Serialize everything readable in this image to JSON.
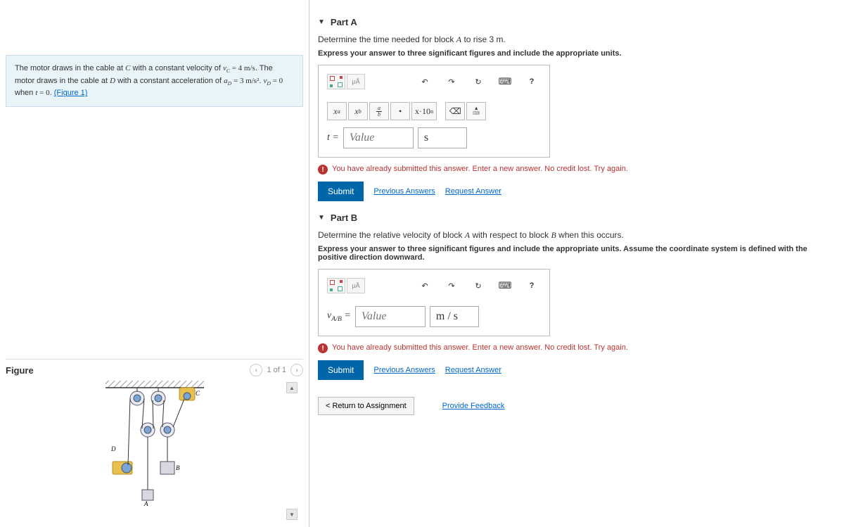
{
  "problem": {
    "text_prefix": "The motor draws in the cable at ",
    "var_c": "C",
    "text_mid1": " with a constant velocity of ",
    "vc": "v_C = 4 m/s",
    "text_mid2": ". The motor draws in the cable at ",
    "var_d": "D",
    "text_mid3": " with a constant acceleration of ",
    "ad": "a_D = 3 m/s²",
    "text_mid4": ". ",
    "vd": "v_D = 0",
    "text_mid5": " when ",
    "t0": "t = 0",
    "text_end": ". ",
    "figure_link": "(Figure 1)"
  },
  "figure": {
    "title": "Figure",
    "page": "1 of 1",
    "labels": {
      "a": "A",
      "b": "B",
      "c": "C",
      "d": "D"
    }
  },
  "partA": {
    "label": "Part A",
    "question_prefix": "Determine the time needed for block ",
    "var_a": "A",
    "question_suffix": " to rise 3 m.",
    "instruction": "Express your answer to three significant figures and include the appropriate units.",
    "var_label": "t =",
    "value_placeholder": "Value",
    "unit_value": "s",
    "feedback": "You have already submitted this answer. Enter a new answer. No credit lost. Try again.",
    "submit": "Submit",
    "prev_answers": "Previous Answers",
    "request_answer": "Request Answer",
    "tools": {
      "xa": "xᵃ",
      "xb": "x_b",
      "frac": "a/b",
      "dot": "•",
      "sci": "x·10ⁿ"
    }
  },
  "partB": {
    "label": "Part B",
    "question_prefix": "Determine the relative velocity of block ",
    "var_a": "A",
    "question_mid": " with respect to block ",
    "var_b": "B",
    "question_suffix": " when this occurs.",
    "instruction": "Express your answer to three significant figures and include the appropriate units. Assume the coordinate system is defined with the positive direction downward.",
    "var_label": "v_{A/B} =",
    "value_placeholder": "Value",
    "unit_value": "m / s",
    "feedback": "You have already submitted this answer. Enter a new answer. No credit lost. Try again.",
    "submit": "Submit",
    "prev_answers": "Previous Answers",
    "request_answer": "Request Answer"
  },
  "bottom": {
    "return": "Return to Assignment",
    "feedback": "Provide Feedback"
  },
  "icons": {
    "help": "?",
    "undo": "↶",
    "redo": "↷",
    "reset": "↻",
    "keyboard": "⌨"
  }
}
